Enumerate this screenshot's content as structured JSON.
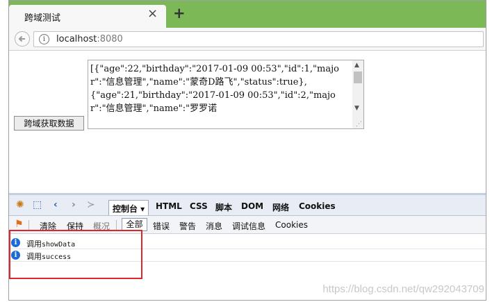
{
  "browser": {
    "tab_title": "跨域测试",
    "tab_close": "×",
    "new_tab": "+",
    "url_host": "localhost",
    "url_port": ":8080"
  },
  "page": {
    "fetch_button_label": "跨域获取数据",
    "result_text": "[{\"age\":22,\"birthday\":\"2017-01-09 00:53\",\"id\":1,\"major\":\"信息管理\",\"name\":\"蒙奇D路飞\",\"status\":true},\n{\"age\":21,\"birthday\":\"2017-01-09 00:53\",\"id\":2,\"major\":\"信息管理\",\"name\":\"罗罗诺"
  },
  "devtools": {
    "tabs": [
      {
        "label": "控制台 ▾"
      },
      {
        "label": "HTML"
      },
      {
        "label": "CSS"
      },
      {
        "label": "脚本"
      },
      {
        "label": "DOM"
      },
      {
        "label": "网络"
      },
      {
        "label": "Cookies"
      }
    ],
    "toolbar": {
      "clear": "清除",
      "persist": "保持",
      "profile": "概况",
      "all": "全部",
      "errors": "错误",
      "warnings": "警告",
      "info": "消息",
      "debug": "调试信息",
      "cookies": "Cookies"
    },
    "logs": [
      {
        "prefix": "调用",
        "fn": "showData"
      },
      {
        "prefix": "调用",
        "fn": "success"
      }
    ]
  },
  "watermark": "https://blog.csdn.net/qw292043709",
  "colors": {
    "accent": "#7cb956",
    "highlight": "#e0242b",
    "info_icon": "#1a6bd4"
  }
}
